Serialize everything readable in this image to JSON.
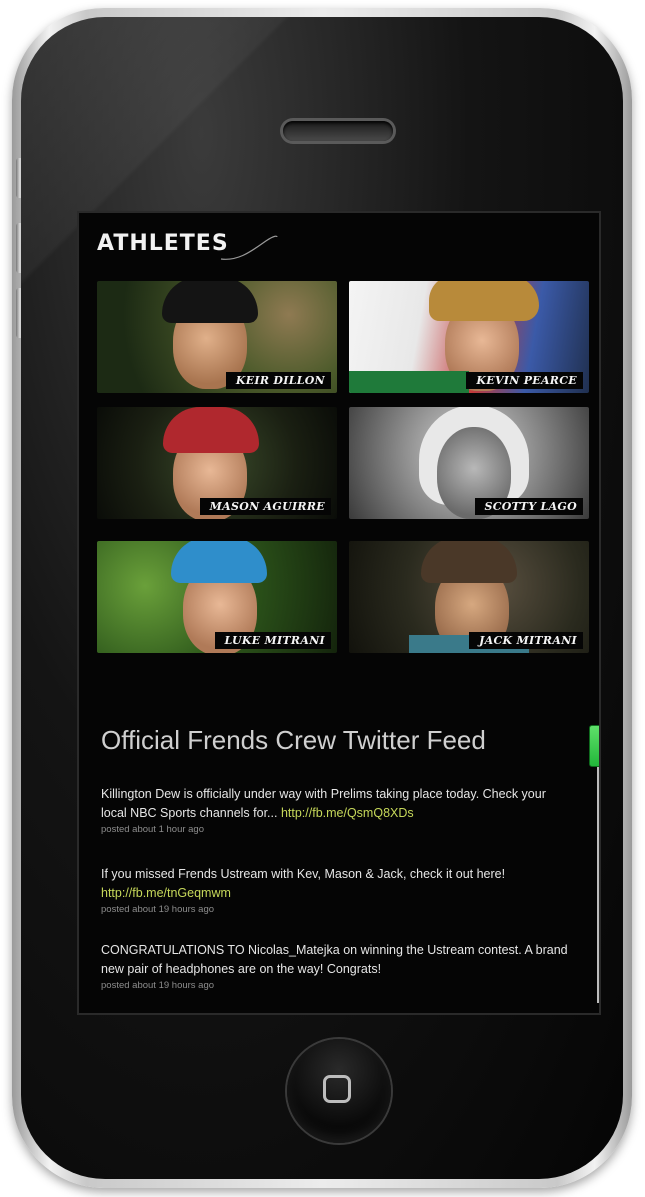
{
  "section": {
    "title": "ATHLETES"
  },
  "athletes": [
    {
      "name": "KEIR DILLON"
    },
    {
      "name": "KEVIN PEARCE"
    },
    {
      "name": "MASON AGUIRRE"
    },
    {
      "name": "SCOTTY LAGO"
    },
    {
      "name": "LUKE MITRANI"
    },
    {
      "name": "JACK MITRANI"
    }
  ],
  "feed": {
    "title": "Official Frends Crew Twitter Feed",
    "tweets": [
      {
        "text": "Killington Dew is officially under way with Prelims taking place today. Check your local NBC Sports channels for... ",
        "link": "http://fb.me/QsmQ8XDs",
        "meta": "posted about 1 hour ago"
      },
      {
        "text": "If you missed Frends Ustream with Kev, Mason & Jack, check it out here! ",
        "link": "http://fb.me/tnGeqmwm",
        "meta": "posted about 19 hours ago"
      },
      {
        "text": "CONGRATULATIONS TO Nicolas_Matejka on winning the Ustream contest. A brand new pair of headphones are on the way! Congrats!",
        "link": "",
        "meta": "posted about 19 hours ago"
      }
    ]
  },
  "colors": {
    "link": "#c6d85a",
    "scroll_thumb": "#3cc84c",
    "screen_bg": "#050505"
  },
  "icons": {
    "home_button": "home-square-icon",
    "speaker": "earpiece-speaker"
  }
}
